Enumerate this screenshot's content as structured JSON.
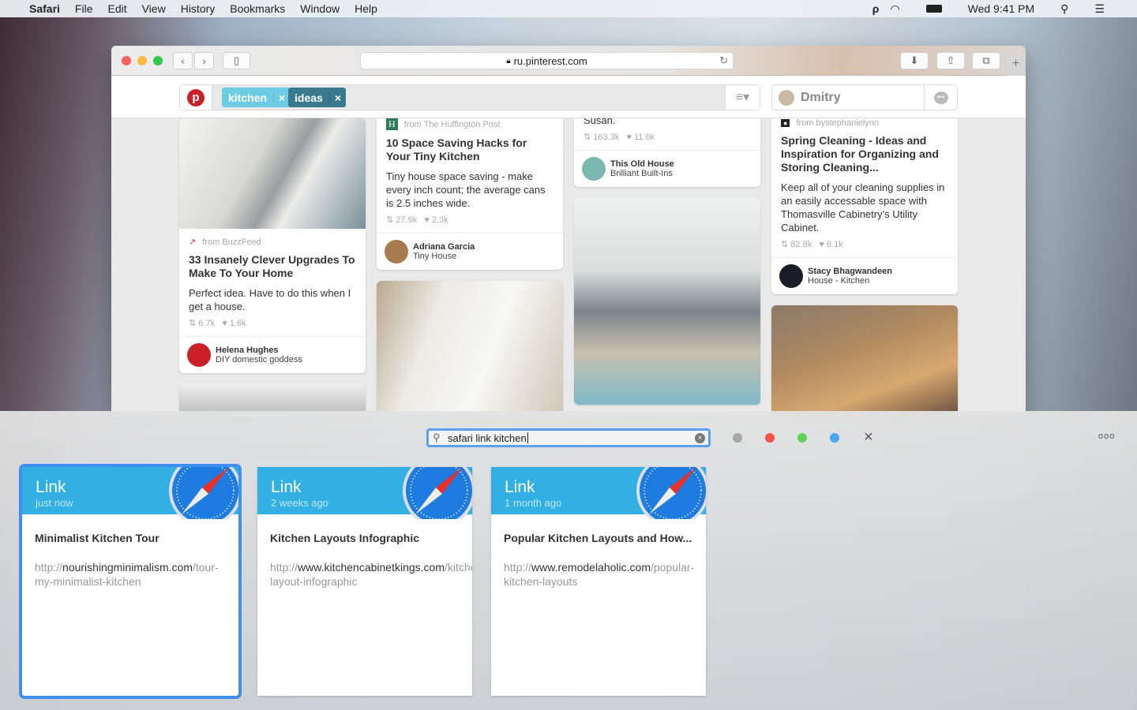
{
  "menubar": {
    "app": "Safari",
    "items": [
      "File",
      "Edit",
      "View",
      "History",
      "Bookmarks",
      "Window",
      "Help"
    ],
    "clock": "Wed 9:41 PM"
  },
  "browser": {
    "url": "ru.pinterest.com"
  },
  "pinterest": {
    "tags": [
      "kitchen",
      "ideas"
    ],
    "user": "Dmitry",
    "pins": [
      {
        "source": "from BuzzFeed",
        "title": "33 Insanely Clever Upgrades To Make To Your Home",
        "desc": "Perfect idea. Have to do this when I get a house.",
        "repins": "6.7k",
        "likes": "1.6k",
        "owner": "Helena Hughes",
        "board": "DIY domestic goddess"
      },
      {
        "source": "from The Huffington Post",
        "title": "10 Space Saving Hacks for Your Tiny Kitchen",
        "desc": "Tiny house space saving - make every inch count; the average cans is 2.5 inches wide.",
        "repins": "27.9k",
        "likes": "2.3k",
        "owner": "Adriana Garcia",
        "board": "Tiny House"
      },
      {
        "desc": "Susan.",
        "repins": "163.3k",
        "likes": "11.6k",
        "owner": "This Old House",
        "board": "Brilliant Built-Ins"
      },
      {
        "source": "from bystephanielynn",
        "title": "Spring Cleaning - Ideas and Inspiration for Organizing and Storing Cleaning...",
        "desc": "Keep all of your cleaning supplies in an easily accessable space with Thomasville Cabinetry's Utility Cabinet.",
        "repins": "82.8k",
        "likes": "6.1k",
        "owner": "Stacy Bhagwandeen",
        "board": "House - Kitchen"
      }
    ]
  },
  "search": {
    "query": "safari link kitchen",
    "filter_colors": [
      "#a8a8a8",
      "#f0524a",
      "#5fd15a",
      "#4aa8ee"
    ],
    "results": [
      {
        "kind": "Link",
        "when": "just now",
        "title": "Minimalist Kitchen Tour",
        "scheme": "http://",
        "domain": "nourishingminimalism.com",
        "path": "/tour-my-minimalist-kitchen",
        "selected": true
      },
      {
        "kind": "Link",
        "when": "2 weeks ago",
        "title": "Kitchen Layouts Infographic",
        "scheme": "http://",
        "domain": "www.kitchencabinetkings.com",
        "path": "/kitchen-layout-infographic",
        "selected": false
      },
      {
        "kind": "Link",
        "when": "1 month ago",
        "title": "Popular Kitchen Layouts and How...",
        "scheme": "http://",
        "domain": "www.remodelaholic.com",
        "path": "/popular-kitchen-layouts",
        "selected": false
      }
    ]
  }
}
